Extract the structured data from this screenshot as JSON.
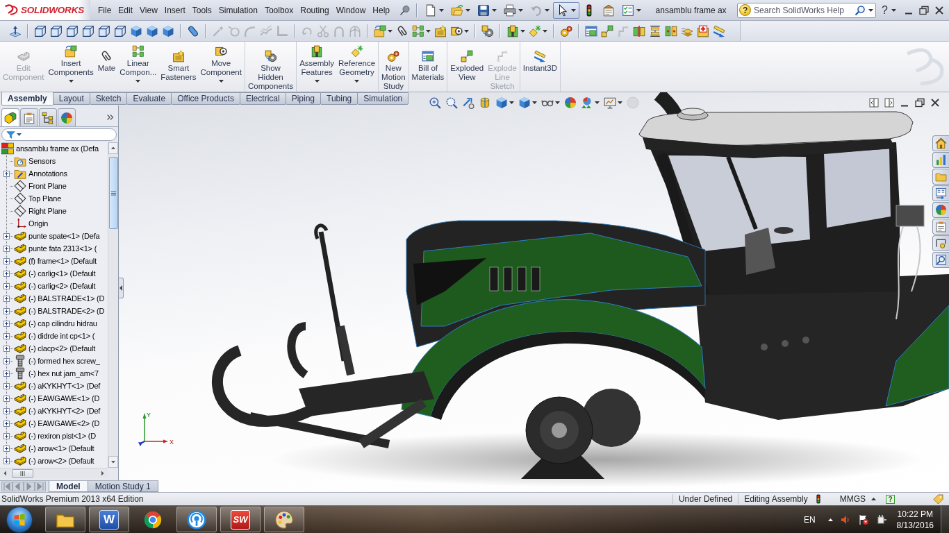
{
  "app": {
    "logo": "SOLIDWORKS"
  },
  "menu": [
    "File",
    "Edit",
    "View",
    "Insert",
    "Tools",
    "Simulation",
    "Toolbox",
    "Routing",
    "Window",
    "Help"
  ],
  "quick_access": [
    {
      "disabled": false,
      "pressed": false,
      "dropdown": true
    },
    {
      "disabled": false,
      "pressed": false,
      "dropdown": true
    },
    {
      "disabled": false,
      "pressed": false,
      "dropdown": true
    },
    {
      "disabled": false,
      "pressed": false,
      "dropdown": true
    },
    {
      "disabled": true,
      "pressed": false,
      "dropdown": true
    },
    {
      "disabled": false,
      "pressed": true,
      "dropdown": true
    },
    {
      "disabled": false,
      "pressed": false
    },
    {
      "disabled": false,
      "pressed": false
    },
    {
      "disabled": false,
      "pressed": false,
      "dropdown": true
    }
  ],
  "document_title": "ansamblu frame ax",
  "search": {
    "badge": "?",
    "placeholder": "Search SolidWorks Help"
  },
  "help_menu": "?",
  "command_toolbar": {
    "groups": [
      {
        "items": [
          {
            "disabled": false
          }
        ]
      },
      {
        "items": [
          {
            "disabled": false
          },
          {
            "disabled": false
          },
          {
            "disabled": false
          },
          {
            "disabled": false
          },
          {
            "disabled": false
          },
          {
            "disabled": false
          },
          {
            "disabled": false
          },
          {
            "disabled": false
          },
          {
            "disabled": false
          }
        ]
      },
      {
        "items": [
          {
            "disabled": false
          }
        ]
      },
      {
        "items": [
          {
            "disabled": true
          },
          {
            "disabled": true
          },
          {
            "disabled": true
          },
          {
            "disabled": true
          },
          {
            "disabled": true
          }
        ]
      },
      {
        "items": [
          {
            "disabled": true
          },
          {
            "disabled": true
          },
          {
            "disabled": true
          },
          {
            "disabled": true
          }
        ]
      },
      {
        "items": [
          {
            "disabled": false,
            "dropdown": true
          },
          {
            "disabled": false
          },
          {
            "disabled": false,
            "dropdown": true
          },
          {
            "disabled": false
          },
          {
            "disabled": false,
            "dropdown": true
          }
        ]
      },
      {
        "items": [
          {
            "disabled": false
          }
        ]
      },
      {
        "items": [
          {
            "disabled": false,
            "dropdown": true
          },
          {
            "disabled": false,
            "dropdown": true
          }
        ]
      },
      {
        "items": [
          {
            "disabled": false
          }
        ]
      },
      {
        "items": [
          {
            "disabled": false
          },
          {
            "disabled": false
          },
          {
            "disabled": true
          },
          {
            "disabled": false
          },
          {
            "disabled": false
          },
          {
            "disabled": false
          },
          {
            "disabled": false
          },
          {
            "disabled": false
          },
          {
            "disabled": false
          }
        ]
      }
    ]
  },
  "ribbon": {
    "groups": [
      {
        "items": [
          {
            "label_lines": [
              "Edit",
              "Component"
            ],
            "disabled": true
          },
          {
            "label_lines": [
              "Insert",
              "Components"
            ],
            "disabled": false,
            "dropdown": true
          },
          {
            "label_lines": [
              "Mate"
            ],
            "disabled": false
          },
          {
            "label_lines": [
              "Linear",
              "Compon..."
            ],
            "disabled": false,
            "dropdown": true
          },
          {
            "label_lines": [
              "Smart",
              "Fasteners"
            ],
            "disabled": false
          },
          {
            "label_lines": [
              "Move",
              "Component"
            ],
            "disabled": false,
            "dropdown": true
          }
        ]
      },
      {
        "items": [
          {
            "label_lines": [
              "Show",
              "Hidden",
              "Components"
            ],
            "disabled": false
          }
        ]
      },
      {
        "items": [
          {
            "label_lines": [
              "Assembly",
              "Features"
            ],
            "disabled": false,
            "dropdown": true
          },
          {
            "label_lines": [
              "Reference",
              "Geometry"
            ],
            "disabled": false,
            "dropdown": true
          }
        ]
      },
      {
        "items": [
          {
            "label_lines": [
              "New",
              "Motion",
              "Study"
            ],
            "disabled": false
          }
        ]
      },
      {
        "items": [
          {
            "label_lines": [
              "Bill of",
              "Materials"
            ],
            "disabled": false
          }
        ]
      },
      {
        "items": [
          {
            "label_lines": [
              "Exploded",
              "View"
            ],
            "disabled": false
          },
          {
            "label_lines": [
              "Explode",
              "Line",
              "Sketch"
            ],
            "disabled": true
          }
        ]
      },
      {
        "items": [
          {
            "label_lines": [
              "Instant3D"
            ],
            "disabled": false
          }
        ]
      }
    ]
  },
  "command_tabs": [
    {
      "label": "Assembly",
      "selected": true
    },
    {
      "label": "Layout",
      "selected": false
    },
    {
      "label": "Sketch",
      "selected": false
    },
    {
      "label": "Evaluate",
      "selected": false
    },
    {
      "label": "Office Products",
      "selected": false
    },
    {
      "label": "Electrical",
      "selected": false
    },
    {
      "label": "Piping",
      "selected": false
    },
    {
      "label": "Tubing",
      "selected": false
    },
    {
      "label": "Simulation",
      "selected": false
    }
  ],
  "feature_manager": {
    "tabs": [
      {
        "selected": true
      },
      {
        "selected": false
      },
      {
        "selected": false
      },
      {
        "selected": false
      }
    ],
    "tree": {
      "label": "ansamblu frame ax (Defa",
      "kind": "assembly",
      "children": [
        {
          "label": "Sensors",
          "kind": "sensors",
          "expandable": false
        },
        {
          "label": "Annotations",
          "kind": "annotations",
          "expandable": true
        },
        {
          "label": "Front Plane",
          "kind": "plane",
          "expandable": false
        },
        {
          "label": "Top Plane",
          "kind": "plane",
          "expandable": false
        },
        {
          "label": "Right Plane",
          "kind": "plane",
          "expandable": false
        },
        {
          "label": "Origin",
          "kind": "origin",
          "expandable": false
        },
        {
          "label": "punte spate<1> (Defa",
          "kind": "part",
          "expandable": true
        },
        {
          "label": "punte fata 2313<1> (",
          "kind": "part",
          "expandable": true
        },
        {
          "label": "(f) frame<1> (Default",
          "kind": "part",
          "expandable": true
        },
        {
          "label": "(-) carlig<1> (Default",
          "kind": "part",
          "expandable": true
        },
        {
          "label": "(-) carlig<2> (Default",
          "kind": "part",
          "expandable": true
        },
        {
          "label": "(-) BALSTRADE<1> (D",
          "kind": "part",
          "expandable": true
        },
        {
          "label": "(-) BALSTRADE<2> (D",
          "kind": "part",
          "expandable": true
        },
        {
          "label": "(-) cap cilindru hidrau",
          "kind": "part",
          "expandable": true
        },
        {
          "label": "(-) didrde int cp<1> (",
          "kind": "part",
          "expandable": true
        },
        {
          "label": "(-) clacp<2> (Default",
          "kind": "part",
          "expandable": true
        },
        {
          "label": "(-) formed hex screw_",
          "kind": "fastener",
          "expandable": true
        },
        {
          "label": "(-) hex nut jam_am<7",
          "kind": "fastener",
          "expandable": true
        },
        {
          "label": "(-) aKYKHYT<1> (Def",
          "kind": "part",
          "expandable": true
        },
        {
          "label": "(-) EAWGAWE<1> (D",
          "kind": "part",
          "expandable": true
        },
        {
          "label": "(-) aKYKHYT<2> (Def",
          "kind": "part",
          "expandable": true
        },
        {
          "label": "(-) EAWGAWE<2> (D",
          "kind": "part",
          "expandable": true
        },
        {
          "label": "(-) rexiron pist<1> (D",
          "kind": "part",
          "expandable": true
        },
        {
          "label": "(-) arow<1> (Default",
          "kind": "part",
          "expandable": true
        },
        {
          "label": "(-) arow<2> (Default",
          "kind": "part",
          "expandable": true
        }
      ]
    }
  },
  "view_toolbar": [
    {
      "disabled": false
    },
    {
      "disabled": false
    },
    {
      "disabled": false
    },
    {
      "disabled": false
    },
    {
      "disabled": false,
      "dropdown": true
    },
    {
      "disabled": false,
      "dropdown": true
    },
    {
      "disabled": false,
      "dropdown": true
    },
    {
      "disabled": false
    },
    {
      "disabled": false,
      "dropdown": true
    },
    {
      "disabled": false,
      "dropdown": true
    },
    {
      "disabled": true
    }
  ],
  "triad": {
    "y_label": "Y",
    "x_label": "X"
  },
  "bottom_tabs": [
    {
      "label": "Model",
      "selected": true
    },
    {
      "label": "Motion Study 1",
      "selected": false
    }
  ],
  "status_bar": {
    "edition": "SolidWorks Premium 2013 x64 Edition",
    "state": "Under Defined",
    "mode": "Editing Assembly",
    "units": "MMGS",
    "help": "?"
  },
  "taskbar": {
    "apps": [
      {
        "kind": "folder",
        "running": true
      },
      {
        "kind": "doc_tile",
        "glyph": "W",
        "running": true
      },
      {
        "kind": "browser",
        "running": false
      },
      {
        "kind": "broadcast",
        "running": true
      },
      {
        "kind": "cad_tile",
        "glyph": "SW",
        "running": true
      },
      {
        "kind": "palette",
        "running": true
      }
    ],
    "language": "EN",
    "time": "10:22 PM",
    "date": "8/13/2016"
  }
}
